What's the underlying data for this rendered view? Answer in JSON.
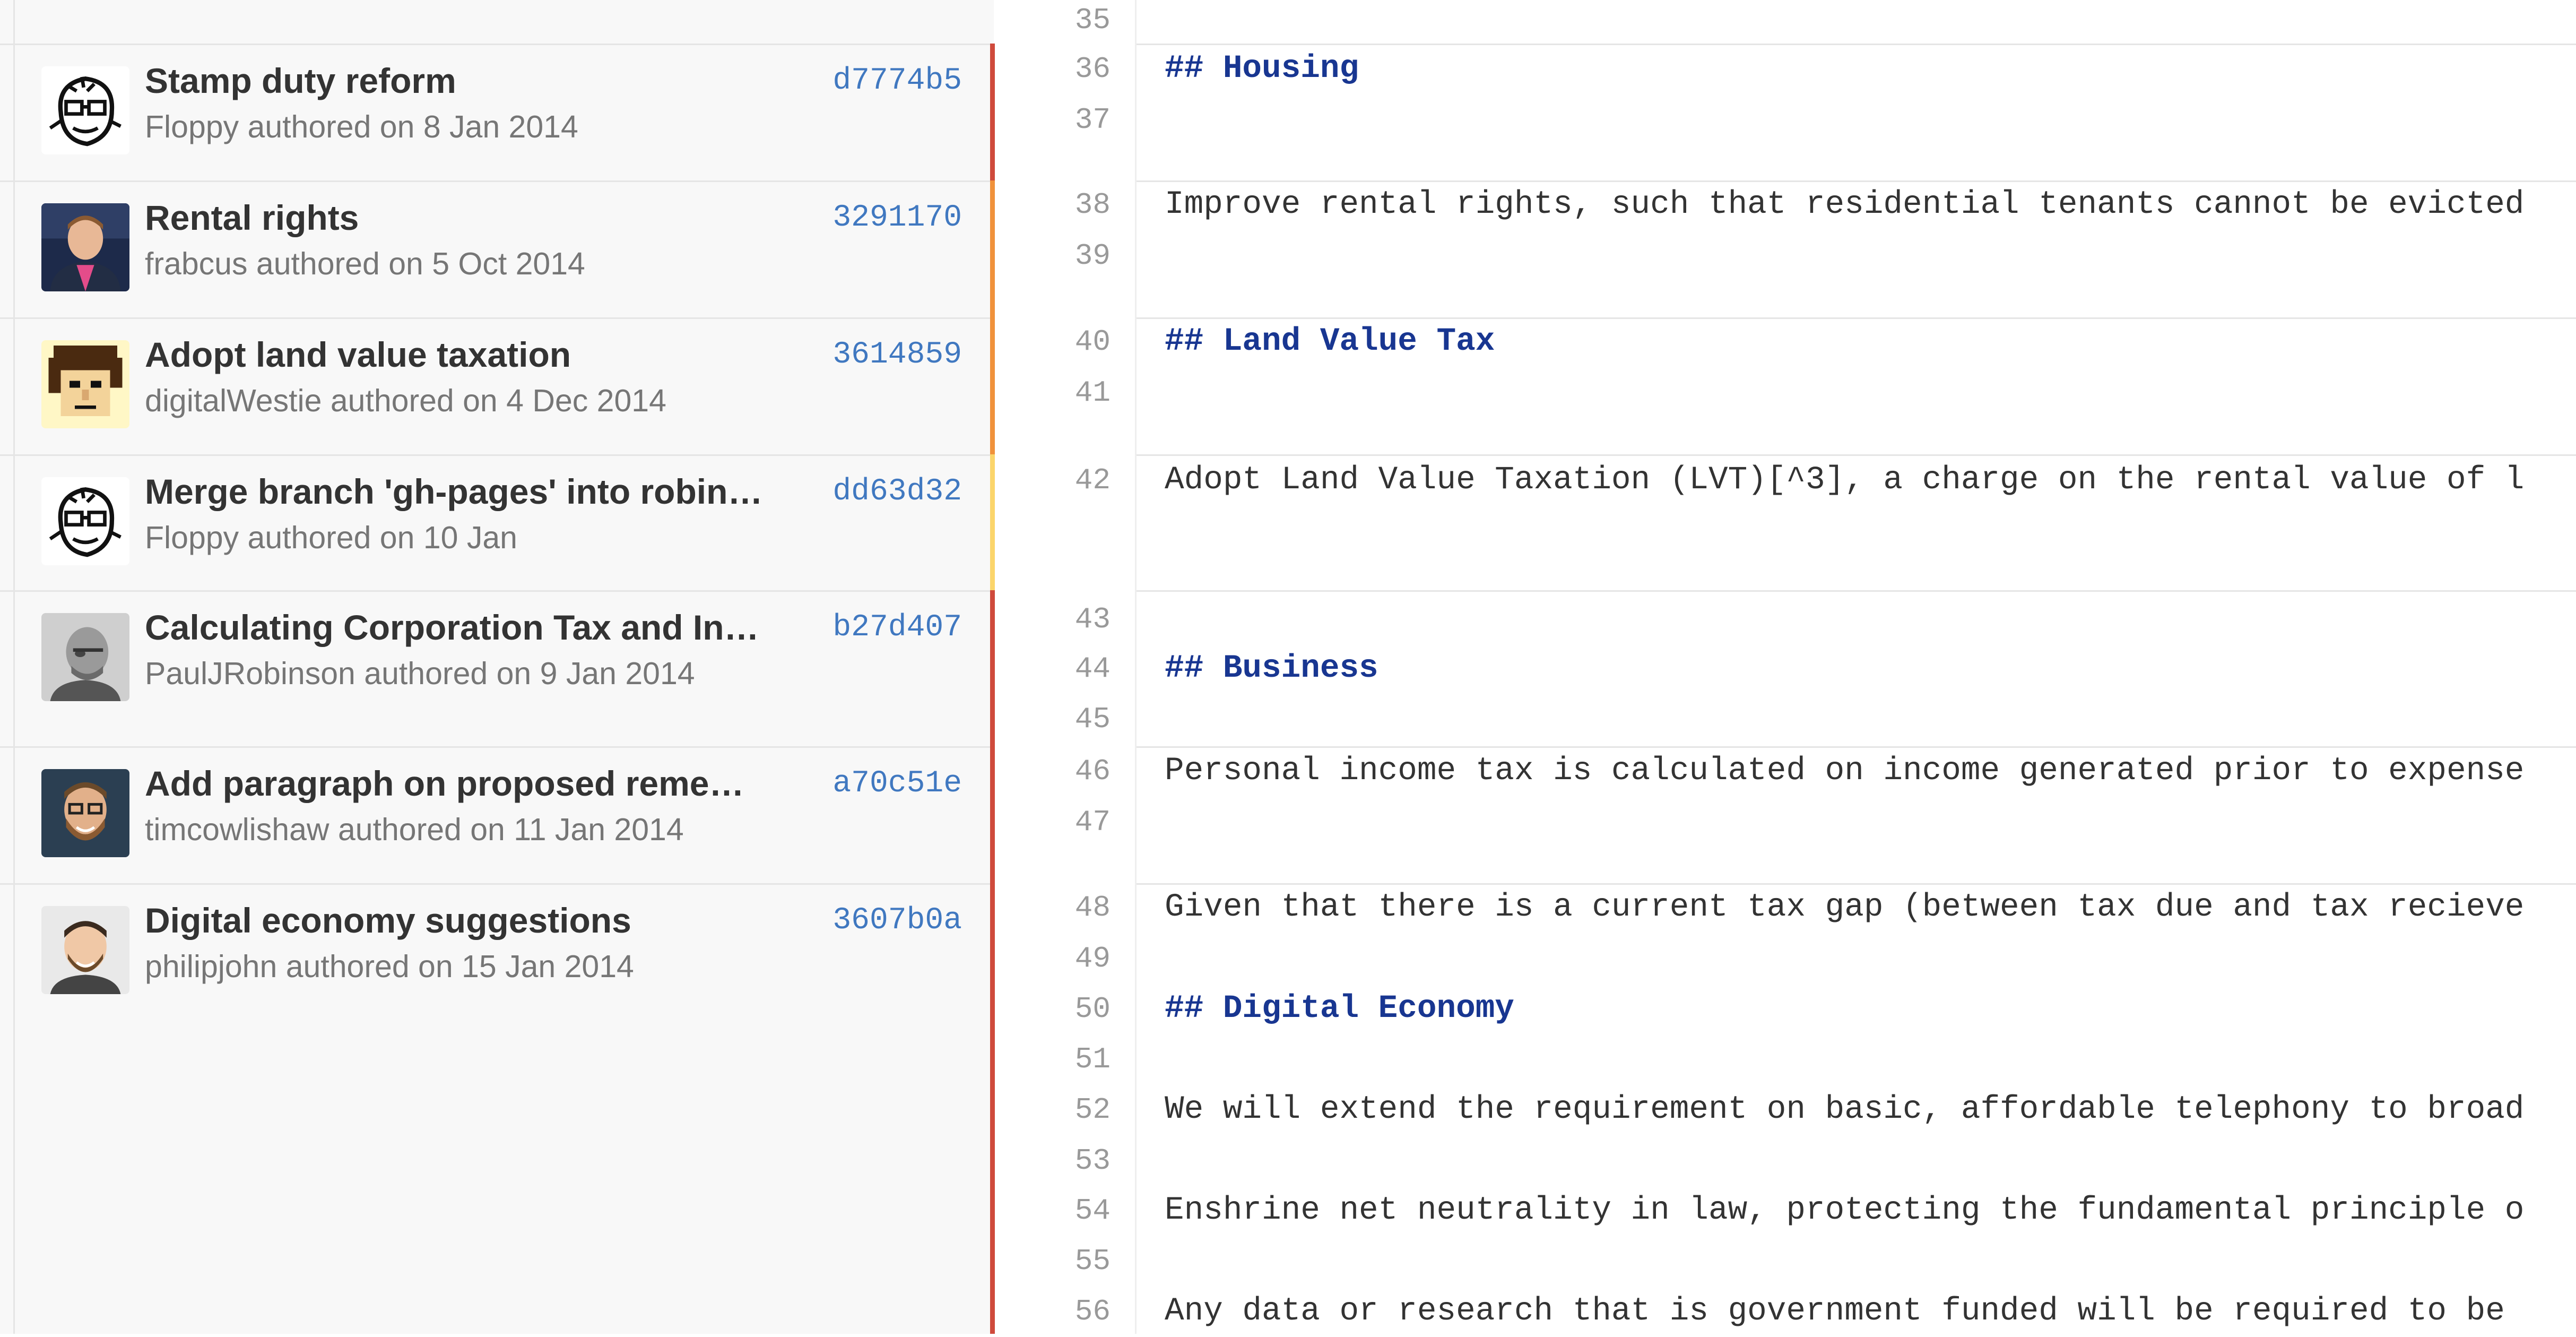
{
  "commits": [
    {
      "message": "Stamp duty reform",
      "author": "Floppy",
      "date_text": "authored on 8 Jan 2014",
      "sha": "d7774b5",
      "avatar": "robot-sketch-avatar",
      "heat_color": "#cf4a3c"
    },
    {
      "message": "Rental rights",
      "author": "frabcus",
      "date_text": "authored on 5 Oct 2014",
      "sha": "3291170",
      "avatar": "man-pink-shirt-photo-avatar",
      "heat_color": "#f0923b"
    },
    {
      "message": "Adopt land value taxation",
      "author": "digitalWestie",
      "date_text": "authored on 4 Dec 2014",
      "sha": "3614859",
      "avatar": "pixel-art-face-avatar",
      "heat_color": "#f0923b"
    },
    {
      "message": "Merge branch 'gh-pages' into robin…",
      "author": "Floppy",
      "date_text": "authored on 10 Jan",
      "sha": "dd63d32",
      "avatar": "robot-sketch-avatar",
      "heat_color": "#fbd56b"
    },
    {
      "message": "Calculating Corporation Tax and In…",
      "author": "PaulJRobinson",
      "date_text": "authored on 9 Jan 2014",
      "sha": "b27d407",
      "avatar": "bald-man-photo-avatar",
      "heat_color": "#cf4a3c"
    },
    {
      "message": "Add paragraph on proposed reme…",
      "author": "timcowlishaw",
      "date_text": "authored on 11 Jan 2014",
      "sha": "a70c51e",
      "avatar": "bearded-man-glasses-photo-avatar",
      "heat_color": "#cf4a3c"
    },
    {
      "message": "Digital economy suggestions",
      "author": "philipjohn",
      "date_text": "authored on 15 Jan 2014",
      "sha": "3607b0a",
      "avatar": "smiling-man-photo-avatar",
      "heat_color": "#cf4a3c"
    }
  ],
  "lines": [
    {
      "num": "35",
      "text": "",
      "heading": false
    },
    {
      "num": "36",
      "text": "## Housing",
      "heading": true
    },
    {
      "num": "37",
      "text": "",
      "heading": false
    },
    {
      "num": "38",
      "text": "Improve rental rights, such that residential tenants cannot be evicted",
      "heading": false
    },
    {
      "num": "39",
      "text": "",
      "heading": false
    },
    {
      "num": "40",
      "text": "## Land Value Tax",
      "heading": true
    },
    {
      "num": "41",
      "text": "",
      "heading": false
    },
    {
      "num": "42",
      "text": "Adopt Land Value Taxation (LVT)[^3], a charge on the rental value of l",
      "heading": false
    },
    {
      "num": "43",
      "text": "",
      "heading": false
    },
    {
      "num": "44",
      "text": "## Business",
      "heading": true
    },
    {
      "num": "45",
      "text": "",
      "heading": false
    },
    {
      "num": "46",
      "text": "Personal income tax is calculated on income generated prior to expense",
      "heading": false
    },
    {
      "num": "47",
      "text": "",
      "heading": false
    },
    {
      "num": "48",
      "text": "Given that there is a current tax gap (between tax due and tax recieve",
      "heading": false
    },
    {
      "num": "49",
      "text": "",
      "heading": false
    },
    {
      "num": "50",
      "text": "## Digital Economy",
      "heading": true
    },
    {
      "num": "51",
      "text": "",
      "heading": false
    },
    {
      "num": "52",
      "text": "We will extend the requirement on basic, affordable telephony to broad",
      "heading": false
    },
    {
      "num": "53",
      "text": "",
      "heading": false
    },
    {
      "num": "54",
      "text": "Enshrine net neutrality in law, protecting the fundamental principle o",
      "heading": false
    },
    {
      "num": "55",
      "text": "",
      "heading": false
    },
    {
      "num": "56",
      "text": "Any data or research that is government funded will be required to be",
      "heading": false
    }
  ]
}
